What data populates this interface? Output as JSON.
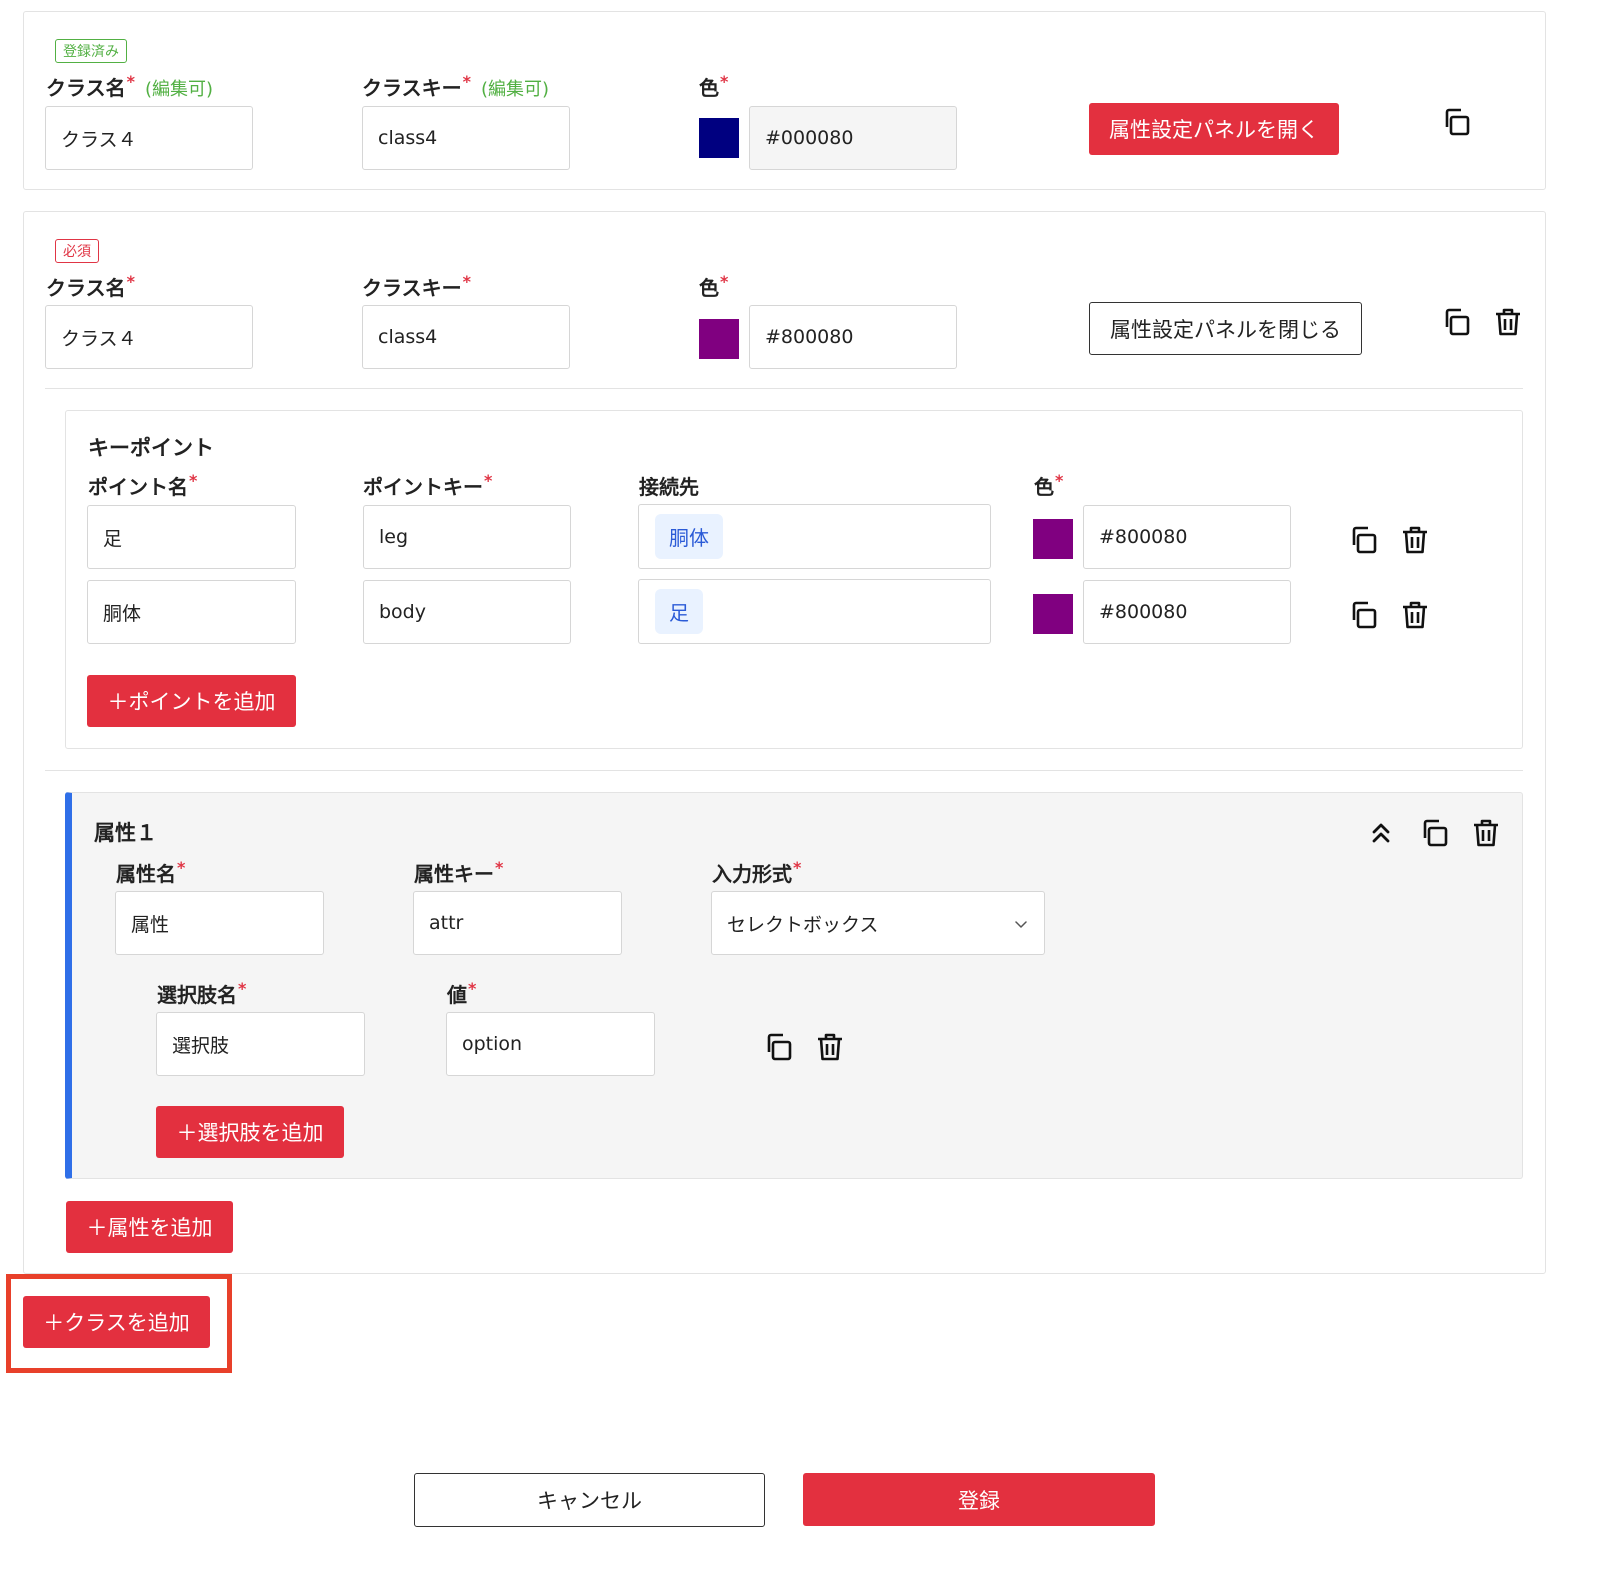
{
  "common": {
    "class_name_label": "クラス名",
    "class_key_label": "クラスキー",
    "color_label": "色",
    "editable_note": "(編集可)",
    "required_mark": "*"
  },
  "class_cards": [
    {
      "status_tag": "登録済み",
      "class_name": "クラス４",
      "class_key": "class4",
      "color_value": "#000080",
      "panel_button": "属性設定パネルを開く"
    },
    {
      "status_tag": "必須",
      "class_name": "クラス４",
      "class_key": "class4",
      "color_value": "#800080",
      "panel_button": "属性設定パネルを閉じる"
    }
  ],
  "keypoints": {
    "title": "キーポイント",
    "point_name_label": "ポイント名",
    "point_key_label": "ポイントキー",
    "connection_label": "接続先",
    "color_label": "色",
    "rows": [
      {
        "name": "足",
        "key": "leg",
        "connection": "胴体",
        "color": "#800080"
      },
      {
        "name": "胴体",
        "key": "body",
        "connection": "足",
        "color": "#800080"
      }
    ],
    "add_button": "＋ポイントを追加"
  },
  "attribute": {
    "title": "属性１",
    "name_label": "属性名",
    "key_label": "属性キー",
    "input_type_label": "入力形式",
    "name_value": "属性",
    "key_value": "attr",
    "input_type_value": "セレクトボックス",
    "option_name_label": "選択肢名",
    "option_value_label": "値",
    "option_name_value": "選択肢",
    "option_value_value": "option",
    "add_option_button": "＋選択肢を追加"
  },
  "add_attribute_button": "＋属性を追加",
  "add_class_button": "＋クラスを追加",
  "footer": {
    "cancel_label": "キャンセル",
    "submit_label": "登録"
  },
  "colors": {
    "navy": "#000080",
    "purple": "#800080",
    "brand_red": "#e3303f",
    "accent_blue": "#2f6fe8",
    "highlight_frame": "#e8402a"
  }
}
